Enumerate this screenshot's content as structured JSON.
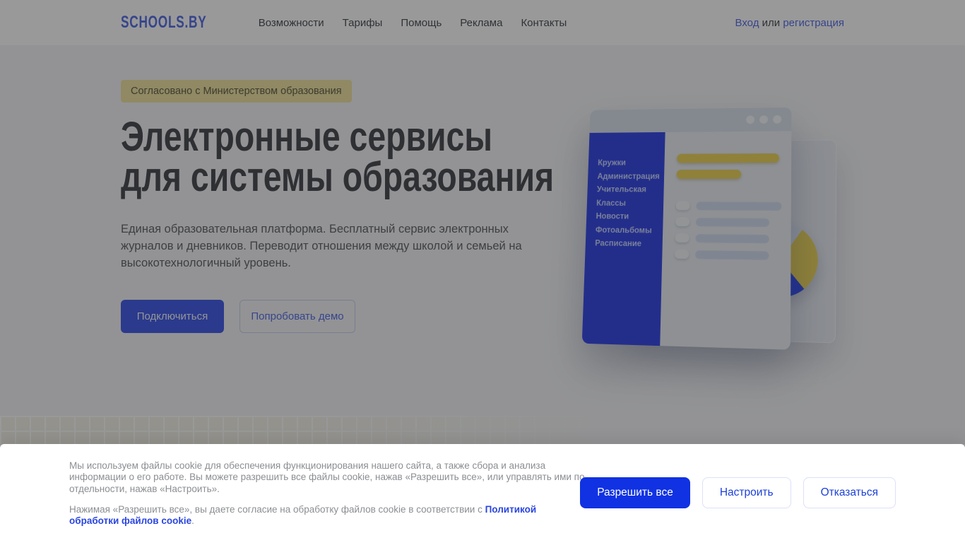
{
  "header": {
    "logo": "SCHOOLS.BY",
    "nav": [
      "Возможности",
      "Тарифы",
      "Помощь",
      "Реклама",
      "Контакты"
    ],
    "auth": {
      "login": "Вход",
      "separator": " или ",
      "register": "регистрация"
    }
  },
  "hero": {
    "badge": "Согласовано с Министерством образования",
    "title_line1": "Электронные сервисы",
    "title_line2": "для системы образования",
    "description": "Единая образовательная платформа. Бесплатный сервис электронных журналов и дневников. Переводит отношения между школой и семьей на высокотехнологичный уровень.",
    "cta_primary": "Подключиться",
    "cta_secondary": "Попробовать демо"
  },
  "illustration": {
    "menu": [
      "Кружки",
      "Администрация",
      "Учительская",
      "Классы",
      "Новости",
      "Фотоальбомы",
      "Расписание"
    ]
  },
  "cookie_banner": {
    "paragraph1": "Мы используем файлы cookie для обеспечения функционирования нашего сайта, а также сбора и анализа информации о его работе. Вы можете разрешить все файлы cookie, нажав «Разрешить все», или управлять ими по отдельности, нажав «Настроить».",
    "paragraph2_before": "Нажимая «Разрешить все», вы даете согласие на обработку файлов cookie в соответствии с ",
    "paragraph2_link": "Политикой обработки файлов cookie",
    "paragraph2_after": ".",
    "allow_button": "Разрешить все",
    "configure_button": "Настроить",
    "decline_button": "Отказаться"
  },
  "colors": {
    "accent": "#1032e3",
    "link_blue": "#2a46e0",
    "brand_blue": "#5b74e8",
    "hero_button": "#4961e9",
    "sidebar_blue": "#3b4ee8",
    "pie_blue": "#3b52f0",
    "illustration_yellow": "#eed761",
    "badge_bg": "#f0e5a6"
  }
}
